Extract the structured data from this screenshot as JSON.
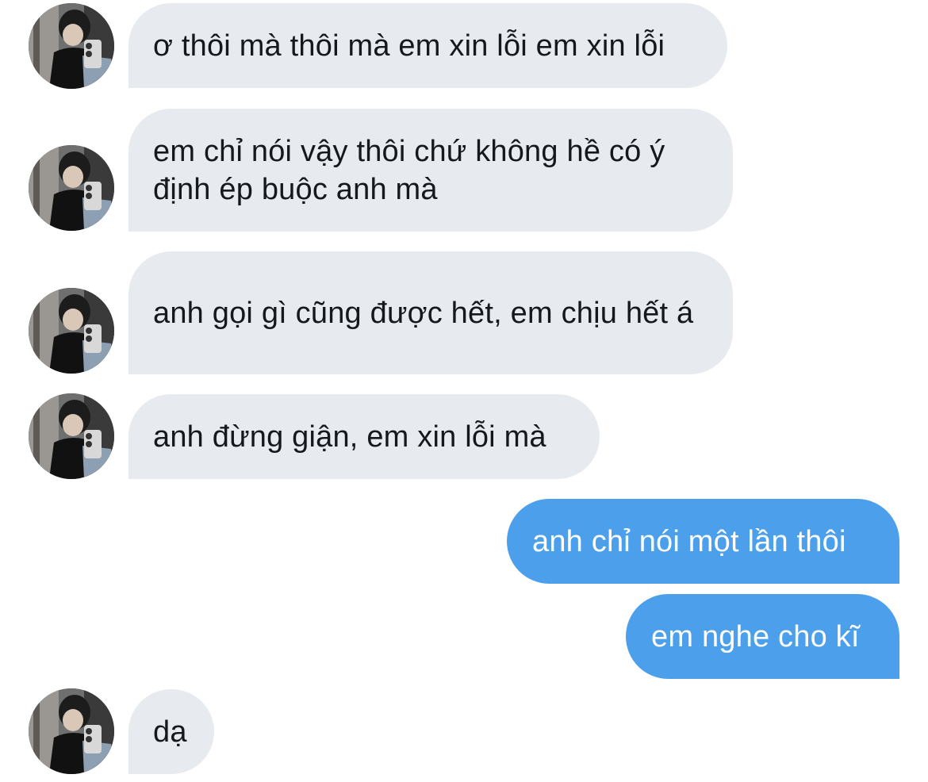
{
  "conversation": {
    "messages": [
      {
        "direction": "in",
        "text": "ơ thôi mà thôi mà em xin lỗi em xin lỗi"
      },
      {
        "direction": "in",
        "text": "em chỉ nói vậy thôi chứ không hề có ý định ép buộc anh mà"
      },
      {
        "direction": "in",
        "text": "anh gọi gì cũng được hết, em chịu hết á"
      },
      {
        "direction": "in",
        "text": "anh đừng giận, em xin lỗi mà"
      },
      {
        "direction": "out",
        "text": "anh chỉ nói một lần thôi"
      },
      {
        "direction": "out",
        "text": "em nghe cho kĩ"
      },
      {
        "direction": "in",
        "text": "dạ"
      }
    ]
  },
  "colors": {
    "incoming_bubble": "#e7ebef",
    "incoming_text": "#15181c",
    "outgoing_bubble": "#4c9fea",
    "outgoing_text": "#ffffff",
    "background": "#ffffff"
  }
}
